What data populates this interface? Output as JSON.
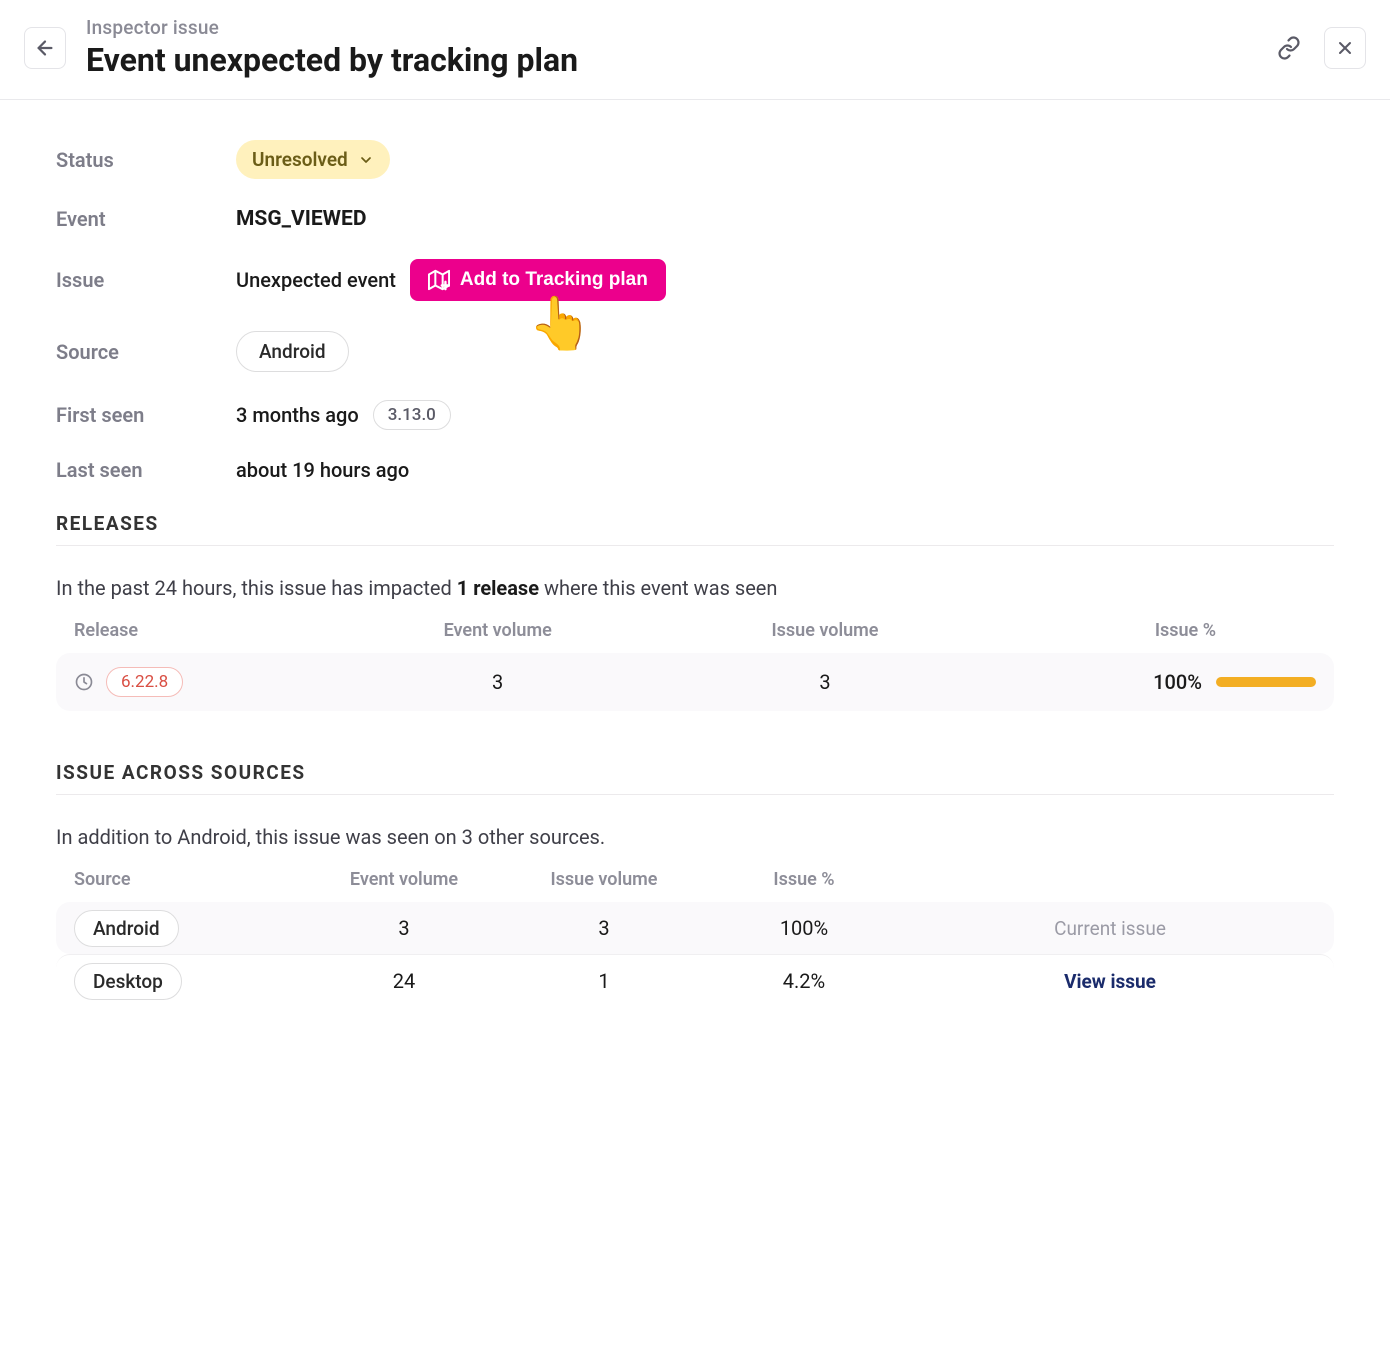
{
  "header": {
    "eyebrow": "Inspector issue",
    "title": "Event unexpected by tracking plan"
  },
  "meta": {
    "status_label": "Status",
    "status_value": "Unresolved",
    "event_label": "Event",
    "event_value": "MSG_VIEWED",
    "issue_label": "Issue",
    "issue_value": "Unexpected event",
    "add_btn": "Add to Tracking plan",
    "source_label": "Source",
    "source_value": "Android",
    "first_seen_label": "First seen",
    "first_seen_value": "3 months ago",
    "first_seen_version": "3.13.0",
    "last_seen_label": "Last seen",
    "last_seen_value": "about 19 hours ago"
  },
  "releases": {
    "title": "RELEASES",
    "sub_pre": "In the past 24 hours, this issue has impacted ",
    "sub_bold": "1 release",
    "sub_post": " where this event was seen",
    "headers": [
      "Release",
      "Event volume",
      "Issue volume",
      "Issue %"
    ],
    "row": {
      "version": "6.22.8",
      "event_volume": "3",
      "issue_volume": "3",
      "issue_pct": "100%"
    }
  },
  "sources": {
    "title": "ISSUE ACROSS SOURCES",
    "sub": "In addition to Android, this issue was seen on 3 other sources.",
    "headers": [
      "Source",
      "Event volume",
      "Issue volume",
      "Issue %"
    ],
    "rows": [
      {
        "source": "Android",
        "event_volume": "3",
        "issue_volume": "3",
        "issue_pct": "100%",
        "action": "Current issue",
        "current": true
      },
      {
        "source": "Desktop",
        "event_volume": "24",
        "issue_volume": "1",
        "issue_pct": "4.2%",
        "action": "View issue",
        "current": false
      }
    ]
  }
}
